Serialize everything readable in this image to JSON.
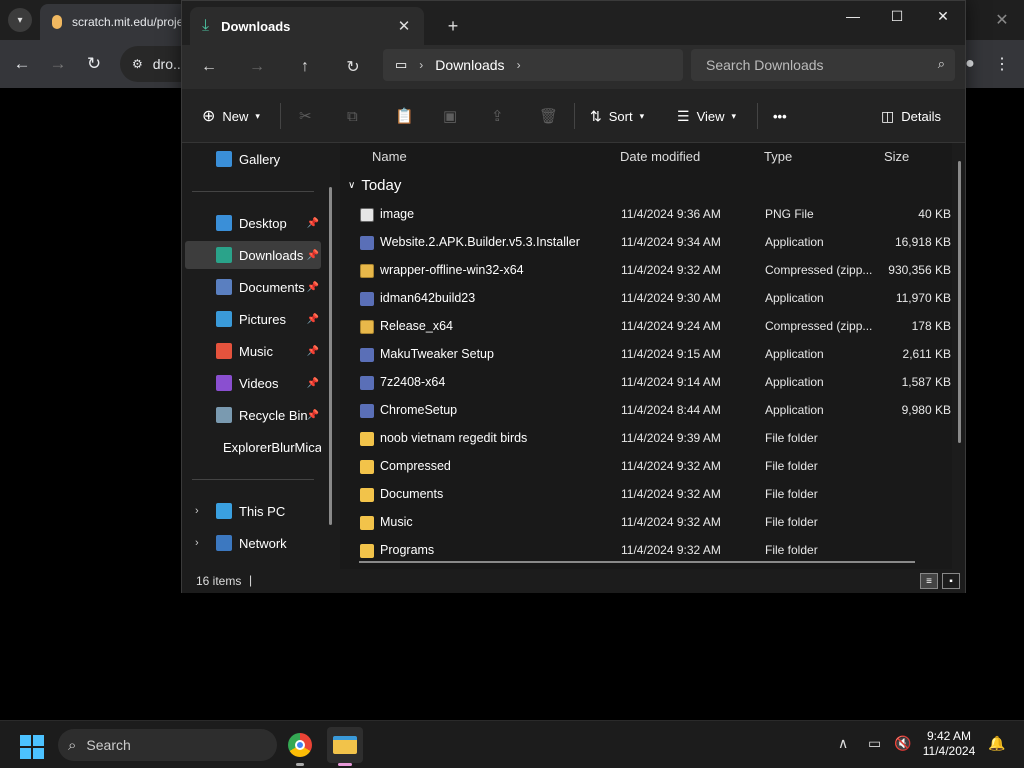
{
  "chrome": {
    "tab_title": "scratch.mit.edu/proje",
    "omnibox_text": "dro..."
  },
  "explorer": {
    "tab_title": "Downloads",
    "address": {
      "location": "Downloads"
    },
    "search_placeholder": "Search Downloads",
    "commands": {
      "new": "New",
      "sort": "Sort",
      "view": "View",
      "more": "•••",
      "details": "Details"
    },
    "nav": {
      "gallery": "Gallery",
      "quick_access": [
        {
          "label": "Desktop",
          "icon": "desktop-icon"
        },
        {
          "label": "Downloads",
          "icon": "downloads-icon"
        },
        {
          "label": "Documents",
          "icon": "documents-icon"
        },
        {
          "label": "Pictures",
          "icon": "pictures-icon"
        },
        {
          "label": "Music",
          "icon": "music-icon"
        },
        {
          "label": "Videos",
          "icon": "videos-icon"
        },
        {
          "label": "Recycle Bin",
          "icon": "recycle-bin-icon"
        },
        {
          "label": "ExplorerBlurMica",
          "icon": "folder-icon"
        }
      ],
      "this_pc": "This PC",
      "network": "Network"
    },
    "columns": {
      "name": "Name",
      "date": "Date modified",
      "type": "Type",
      "size": "Size"
    },
    "group": "Today",
    "files": [
      {
        "name": "image",
        "date": "11/4/2024 9:36 AM",
        "type": "PNG File",
        "size": "40 KB",
        "kind": "png"
      },
      {
        "name": "Website.2.APK.Builder.v5.3.Installer",
        "date": "11/4/2024 9:34 AM",
        "type": "Application",
        "size": "16,918 KB",
        "kind": "app"
      },
      {
        "name": "wrapper-offline-win32-x64",
        "date": "11/4/2024 9:32 AM",
        "type": "Compressed (zipp...",
        "size": "930,356 KB",
        "kind": "zip"
      },
      {
        "name": "idman642build23",
        "date": "11/4/2024 9:30 AM",
        "type": "Application",
        "size": "11,970 KB",
        "kind": "app"
      },
      {
        "name": "Release_x64",
        "date": "11/4/2024 9:24 AM",
        "type": "Compressed (zipp...",
        "size": "178 KB",
        "kind": "zip"
      },
      {
        "name": "MakuTweaker Setup",
        "date": "11/4/2024 9:15 AM",
        "type": "Application",
        "size": "2,611 KB",
        "kind": "app"
      },
      {
        "name": "7z2408-x64",
        "date": "11/4/2024 9:14 AM",
        "type": "Application",
        "size": "1,587 KB",
        "kind": "app"
      },
      {
        "name": "ChromeSetup",
        "date": "11/4/2024 8:44 AM",
        "type": "Application",
        "size": "9,980 KB",
        "kind": "app"
      },
      {
        "name": "noob vietnam regedit birds",
        "date": "11/4/2024 9:39 AM",
        "type": "File folder",
        "size": "",
        "kind": "folder"
      },
      {
        "name": "Compressed",
        "date": "11/4/2024 9:32 AM",
        "type": "File folder",
        "size": "",
        "kind": "folder"
      },
      {
        "name": "Documents",
        "date": "11/4/2024 9:32 AM",
        "type": "File folder",
        "size": "",
        "kind": "folder"
      },
      {
        "name": "Music",
        "date": "11/4/2024 9:32 AM",
        "type": "File folder",
        "size": "",
        "kind": "folder"
      },
      {
        "name": "Programs",
        "date": "11/4/2024 9:32 AM",
        "type": "File folder",
        "size": "",
        "kind": "folder"
      }
    ],
    "status": "16 items"
  },
  "taskbar": {
    "search_label": "Search",
    "time": "9:42 AM",
    "date": "11/4/2024"
  }
}
